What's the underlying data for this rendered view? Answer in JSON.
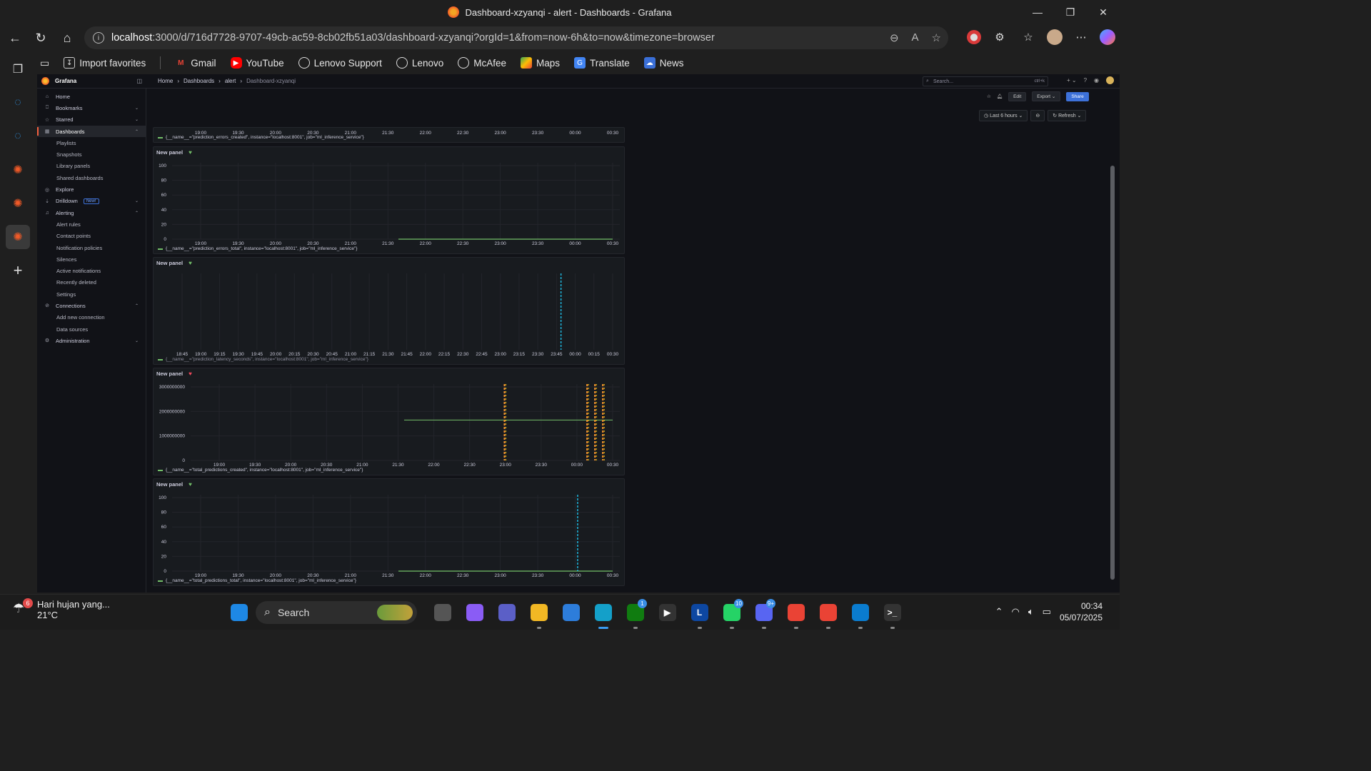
{
  "window": {
    "title": "Dashboard-xzyanqi - alert - Dashboards - Grafana",
    "controls": [
      "—",
      "❐",
      "✕"
    ]
  },
  "browser": {
    "url_host": "localhost",
    "url_rest": ":3000/d/716d7728-9707-49cb-ac59-8cb02fb51a03/dashboard-xzyanqi?orgId=1&from=now-6h&to=now&timezone=browser",
    "bookmarks": [
      {
        "label": "Import favorites",
        "icon": "import-icon",
        "color": "#2b2b2b"
      },
      {
        "label": "Gmail",
        "icon": "gmail-icon",
        "color": "#ea4335"
      },
      {
        "label": "YouTube",
        "icon": "youtube-icon",
        "color": "#ff0000"
      },
      {
        "label": "Lenovo Support",
        "icon": "globe-icon",
        "color": "#2b2b2b"
      },
      {
        "label": "Lenovo",
        "icon": "globe-icon",
        "color": "#2b2b2b"
      },
      {
        "label": "McAfee",
        "icon": "globe-icon",
        "color": "#2b2b2b"
      },
      {
        "label": "Maps",
        "icon": "maps-icon",
        "color": "#34a853"
      },
      {
        "label": "Translate",
        "icon": "translate-icon",
        "color": "#4285f4"
      },
      {
        "label": "News",
        "icon": "news-icon",
        "color": "#3a6fd8"
      }
    ]
  },
  "grafana": {
    "brand": "Grafana",
    "breadcrumb": [
      "Home",
      "Dashboards",
      "alert",
      "Dashboard-xzyanqi"
    ],
    "search_placeholder": "Search...",
    "search_shortcut": "ctrl+k",
    "sidebar": [
      {
        "label": "Home",
        "icon": "home-icon",
        "level": 0
      },
      {
        "label": "Bookmarks",
        "icon": "bookmark-icon",
        "level": 0,
        "chevron": "⌄"
      },
      {
        "label": "Starred",
        "icon": "star-icon",
        "level": 0,
        "chevron": "⌄"
      },
      {
        "label": "Dashboards",
        "icon": "dashboards-icon",
        "level": 0,
        "chevron": "⌃",
        "active": true
      },
      {
        "label": "Playlists",
        "level": 1
      },
      {
        "label": "Snapshots",
        "level": 1
      },
      {
        "label": "Library panels",
        "level": 1
      },
      {
        "label": "Shared dashboards",
        "level": 1
      },
      {
        "label": "Explore",
        "icon": "compass-icon",
        "level": 0
      },
      {
        "label": "Drilldown",
        "icon": "drilldown-icon",
        "level": 0,
        "chevron": "⌄",
        "badge": "New!"
      },
      {
        "label": "Alerting",
        "icon": "bell-icon",
        "level": 0,
        "chevron": "⌃"
      },
      {
        "label": "Alert rules",
        "level": 1
      },
      {
        "label": "Contact points",
        "level": 1
      },
      {
        "label": "Notification policies",
        "level": 1
      },
      {
        "label": "Silences",
        "level": 1
      },
      {
        "label": "Active notifications",
        "level": 1
      },
      {
        "label": "Recently deleted",
        "level": 1
      },
      {
        "label": "Settings",
        "level": 1
      },
      {
        "label": "Connections",
        "icon": "connections-icon",
        "level": 0,
        "chevron": "⌃"
      },
      {
        "label": "Add new connection",
        "level": 1
      },
      {
        "label": "Data sources",
        "level": 1
      },
      {
        "label": "Administration",
        "icon": "gear-icon",
        "level": 0,
        "chevron": "⌄"
      }
    ],
    "toolbar": {
      "edit": "Edit",
      "export": "Export",
      "share": "Share"
    },
    "time_range": "Last 6 hours",
    "refresh": "Refresh"
  },
  "panels": [
    {
      "title": "",
      "state": "",
      "legend": "{__name__=\"prediction_errors_created\", instance=\"localhost:8001\", job=\"ml_inference_service\"}",
      "x_ticks": [
        "19:00",
        "19:30",
        "20:00",
        "20:30",
        "21:00",
        "21:30",
        "22:00",
        "22:30",
        "23:00",
        "23:30",
        "00:00",
        "00:30"
      ],
      "y_ticks": []
    },
    {
      "title": "New panel",
      "state": "ok",
      "legend": "{__name__=\"prediction_errors_total\", instance=\"localhost:8001\", job=\"ml_inference_service\"}",
      "x_ticks": [
        "19:00",
        "19:30",
        "20:00",
        "20:30",
        "21:00",
        "21:30",
        "22:00",
        "22:30",
        "23:00",
        "23:30",
        "00:00",
        "00:30"
      ],
      "y_ticks": [
        "100",
        "80",
        "60",
        "40",
        "20",
        "0"
      ]
    },
    {
      "title": "New panel",
      "state": "ok",
      "legend": "{__name__=\"prediction_latency_seconds\", instance=\"localhost:8001\", job=\"ml_inference_service\"}",
      "x_ticks": [
        "18:45",
        "19:00",
        "19:15",
        "19:30",
        "19:45",
        "20:00",
        "20:15",
        "20:30",
        "20:45",
        "21:00",
        "21:15",
        "21:30",
        "21:45",
        "22:00",
        "22:15",
        "22:30",
        "22:45",
        "23:00",
        "23:15",
        "23:30",
        "23:45",
        "00:00",
        "00:15",
        "00:30"
      ],
      "y_ticks": []
    },
    {
      "title": "New panel",
      "state": "alerting",
      "legend": "{__name__=\"total_predictions_created\", instance=\"localhost:8001\", job=\"ml_inference_service\"}",
      "x_ticks": [
        "19:00",
        "19:30",
        "20:00",
        "20:30",
        "21:00",
        "21:30",
        "22:00",
        "22:30",
        "23:00",
        "23:30",
        "00:00",
        "00:30"
      ],
      "y_ticks": [
        "3000000000",
        "2000000000",
        "1000000000",
        "0"
      ]
    },
    {
      "title": "New panel",
      "state": "ok",
      "legend": "{__name__=\"total_predictions_total\", instance=\"localhost:8001\", job=\"ml_inference_service\"}",
      "x_ticks": [
        "19:00",
        "19:30",
        "20:00",
        "20:30",
        "21:00",
        "21:30",
        "22:00",
        "22:30",
        "23:00",
        "23:30",
        "00:00",
        "00:30"
      ],
      "y_ticks": [
        "100",
        "80",
        "60",
        "40",
        "20",
        "0"
      ]
    }
  ],
  "colors": {
    "series": "#73bf69",
    "ok": "#73bf69",
    "alerting": "#f2495c",
    "annotation_cyan": "#1fb8e0",
    "annotation_orange": "#ff9830"
  },
  "taskbar": {
    "weather_text": "Hari hujan yang...",
    "weather_temp": "21°C",
    "weather_badge": "6",
    "search_label": "Search",
    "time": "00:34",
    "date": "05/07/2025",
    "apps": [
      {
        "name": "start",
        "label": "",
        "color": "#1e88e5"
      },
      {
        "name": "task-view",
        "label": "",
        "color": "#555"
      },
      {
        "name": "copilot",
        "label": "",
        "color": "#8a5cf5"
      },
      {
        "name": "teams",
        "label": "",
        "color": "#5b5fc7"
      },
      {
        "name": "file-explorer",
        "label": "",
        "color": "#f2b824"
      },
      {
        "name": "microsoft-store",
        "label": "",
        "color": "#2d7ddb"
      },
      {
        "name": "edge",
        "label": "",
        "color": "#14a0c9"
      },
      {
        "name": "xbox",
        "label": "",
        "color": "#107c10",
        "badge": "1"
      },
      {
        "name": "media-player",
        "label": "▶",
        "color": "#333"
      },
      {
        "name": "lenovo-l",
        "label": "L",
        "color": "#0d47a1"
      },
      {
        "name": "whatsapp",
        "label": "",
        "color": "#25d366",
        "badge": "10"
      },
      {
        "name": "discord",
        "label": "",
        "color": "#5865f2",
        "badge": "9+"
      },
      {
        "name": "chrome",
        "label": "",
        "color": "#ea4335"
      },
      {
        "name": "chrome-profile",
        "label": "",
        "color": "#ea4335"
      },
      {
        "name": "vscode",
        "label": "",
        "color": "#0a7ccf"
      },
      {
        "name": "terminal",
        "label": ">_",
        "color": "#333"
      }
    ]
  }
}
